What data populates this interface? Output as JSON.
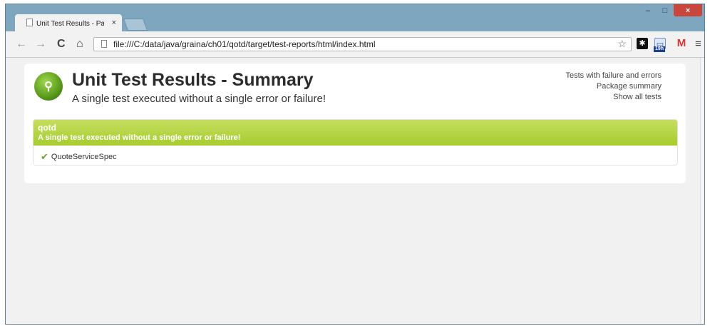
{
  "browser": {
    "tab_title": "Unit Test Results - Packa",
    "tab_close": "×",
    "url": "file:///C:/data/java/graina/ch01/qotd/target/test-reports/html/index.html",
    "window_controls": {
      "minimize": "–",
      "maximize": "□",
      "close": "×"
    },
    "ext_badge": "19h",
    "menu_icon": "≡",
    "nav_icons": {
      "back": "←",
      "forward": "→",
      "reload": "C",
      "home": "⌂",
      "star": "☆",
      "gmail": "M"
    }
  },
  "report": {
    "title": "Unit Test Results - Summary",
    "subtitle": "A single test executed without a single error or failure!",
    "links": [
      "Tests with failure and errors",
      "Package summary",
      "Show all tests"
    ],
    "package": {
      "name": "qotd",
      "description": "A single test executed without a single error or failure!",
      "tests": [
        {
          "name": "QuoteServiceSpec",
          "status": "passed"
        }
      ]
    }
  },
  "colors": {
    "package_header": "#b3d23a",
    "check": "#62a828",
    "window_frame": "#7fa6bf"
  }
}
